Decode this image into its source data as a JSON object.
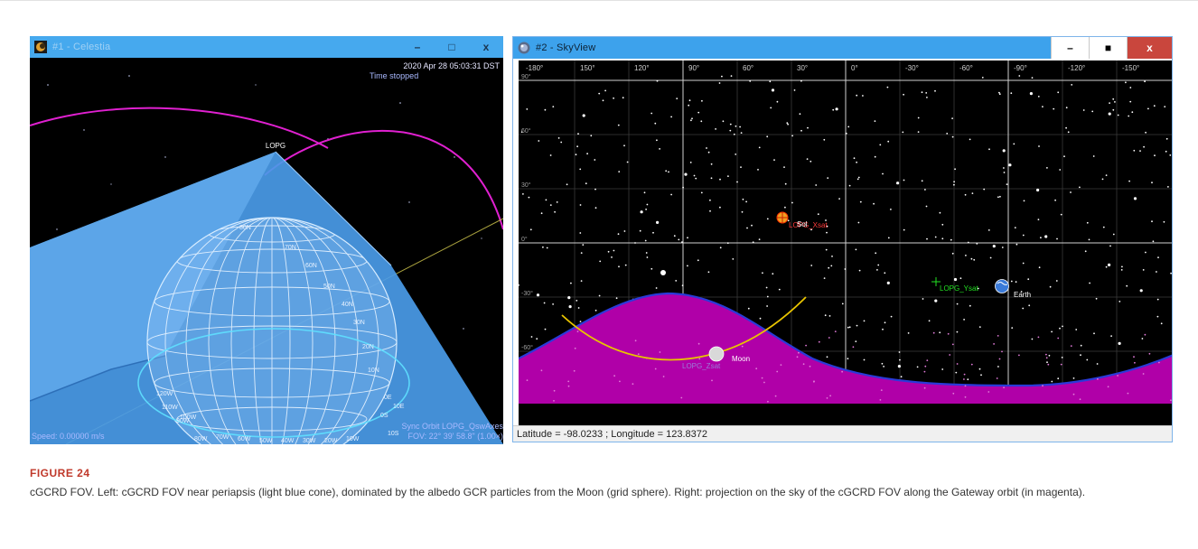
{
  "celestia": {
    "title": "#1 - Celestia",
    "date": "2020 Apr 28 05:03:31 DST",
    "time_status": "Time stopped",
    "target_label": "LOPG",
    "speed": "Speed: 0.00000 m/s",
    "sync_orbit": "Sync Orbit LOPG_QswAxes",
    "fov": "FOV: 22° 39' 58.8\" (1.00×)",
    "grid_labels": [
      "80N",
      "70N",
      "60N",
      "50N",
      "40N",
      "30N",
      "20N",
      "10N",
      "0E",
      "10E",
      "0S",
      "10S",
      "90W",
      "80W",
      "70W",
      "60W",
      "50W",
      "40W",
      "30W",
      "20W",
      "10W",
      "120W",
      "110W",
      "100W"
    ],
    "min_label": "–",
    "max_label": "□",
    "close_label": "x"
  },
  "skyview": {
    "title": "#2 - SkyView",
    "lon_ticks": [
      "-180°",
      "150°",
      "120°",
      "90°",
      "60°",
      "30°",
      "0°",
      "-30°",
      "-60°",
      "-90°",
      "-120°",
      "-150°"
    ],
    "lat_ticks": [
      "90°",
      "60°",
      "30°",
      "0°",
      "-30°",
      "-60°"
    ],
    "objects": {
      "sol": "Sol",
      "lopg_xsat": "LOPG_Xsat",
      "lopg_ysat": "LOPG_Ysat",
      "earth": "Earth",
      "moon": "Moon",
      "lopg_zsat": "LOPG_Zsat"
    },
    "status": "Latitude = -98.0233 ; Longitude = 123.8372",
    "min_label": "–",
    "max_label": "■",
    "close_label": "x"
  },
  "caption": {
    "label": "FIGURE 24",
    "text": "cGCRD FOV. Left: cGCRD FOV near periapsis (light blue cone), dominated by the albedo GCR particles from the Moon (grid sphere). Right: projection on the sky of the cGCRD FOV along the Gateway orbit (in magenta)."
  },
  "colors": {
    "titlebar": "#46a9ee",
    "fov_cone": "#4a9be8",
    "orbit": "#e020d0",
    "sky_fov": "#b000a8",
    "caption_label": "#c0392b"
  }
}
